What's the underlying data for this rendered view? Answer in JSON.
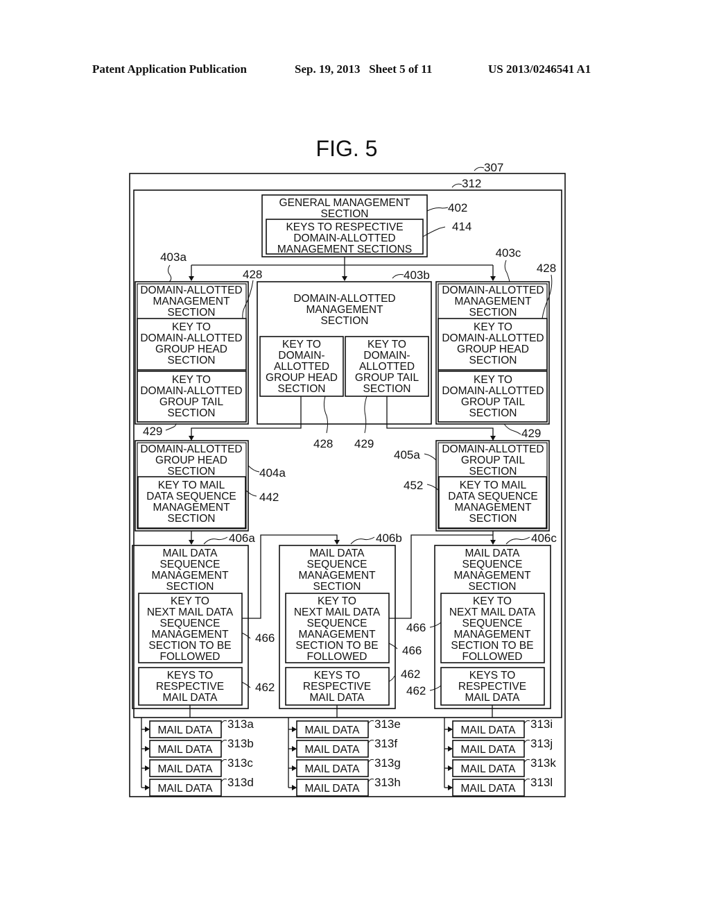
{
  "header": {
    "publication": "Patent Application Publication",
    "date_sheet": "Sep. 19, 2013   Sheet 5 of 11",
    "number": "US 2013/0246541 A1"
  },
  "figure": {
    "title": "FIG. 5",
    "refs": {
      "outer": "307",
      "inner": "312",
      "general": "402",
      "keys_general": "414",
      "dam_a": "403a",
      "dam_b": "403b",
      "dam_c": "403c",
      "head_key": "428",
      "tail_key": "429",
      "head_a": "404a",
      "tail_a": "405a",
      "key_mail_seq_head": "442",
      "key_mail_seq_tail": "452",
      "seq_a": "406a",
      "seq_b": "406b",
      "seq_c": "406c",
      "next_key": "466",
      "keys_mail": "462"
    },
    "general_management": {
      "title": [
        "GENERAL  MANAGEMENT",
        "SECTION"
      ],
      "keys": [
        "KEYS  TO  RESPECTIVE",
        "DOMAIN-ALLOTTED",
        "MANAGEMENT SECTIONS"
      ]
    },
    "domain_allotted": {
      "title": [
        "DOMAIN-ALLOTTED",
        "MANAGEMENT",
        "SECTION"
      ],
      "head_key": [
        "KEY  TO",
        "DOMAIN-ALLOTTED",
        "GROUP  HEAD",
        "SECTION"
      ],
      "tail_key": [
        "KEY  TO",
        "DOMAIN-ALLOTTED",
        "GROUP  TAIL",
        "SECTION"
      ],
      "head_key_narrow": [
        "KEY  TO",
        "DOMAIN-",
        "ALLOTTED",
        "GROUP  HEAD",
        "SECTION"
      ],
      "tail_key_narrow": [
        "KEY  TO",
        "DOMAIN-",
        "ALLOTTED",
        "GROUP  TAIL",
        "SECTION"
      ]
    },
    "group_head": {
      "title": [
        "DOMAIN-ALLOTTED",
        "GROUP  HEAD",
        "SECTION"
      ],
      "key": [
        "KEY  TO  MAIL",
        "DATA SEQUENCE",
        "MANAGEMENT",
        "SECTION"
      ]
    },
    "group_tail": {
      "title": [
        "DOMAIN-ALLOTTED",
        "GROUP  TAIL",
        "SECTION"
      ],
      "key": [
        "KEY  TO  MAIL",
        "DATA SEQUENCE",
        "MANAGEMENT",
        "SECTION"
      ]
    },
    "mail_sequence": {
      "title": [
        "MAIL  DATA",
        "SEQUENCE",
        "MANAGEMENT",
        "SECTION"
      ],
      "next_key": [
        "KEY  TO",
        "NEXT  MAIL  DATA",
        "SEQUENCE",
        "MANAGEMENT",
        "SECTION  TO  BE",
        "FOLLOWED"
      ],
      "mail_keys": [
        "KEYS  TO",
        "RESPECTIVE",
        "MAIL  DATA"
      ]
    },
    "mail_data_label": "MAIL  DATA",
    "mail_data_columns": [
      [
        "313a",
        "313b",
        "313c",
        "313d"
      ],
      [
        "313e",
        "313f",
        "313g",
        "313h"
      ],
      [
        "313i",
        "313j",
        "313k",
        "313l"
      ]
    ]
  }
}
